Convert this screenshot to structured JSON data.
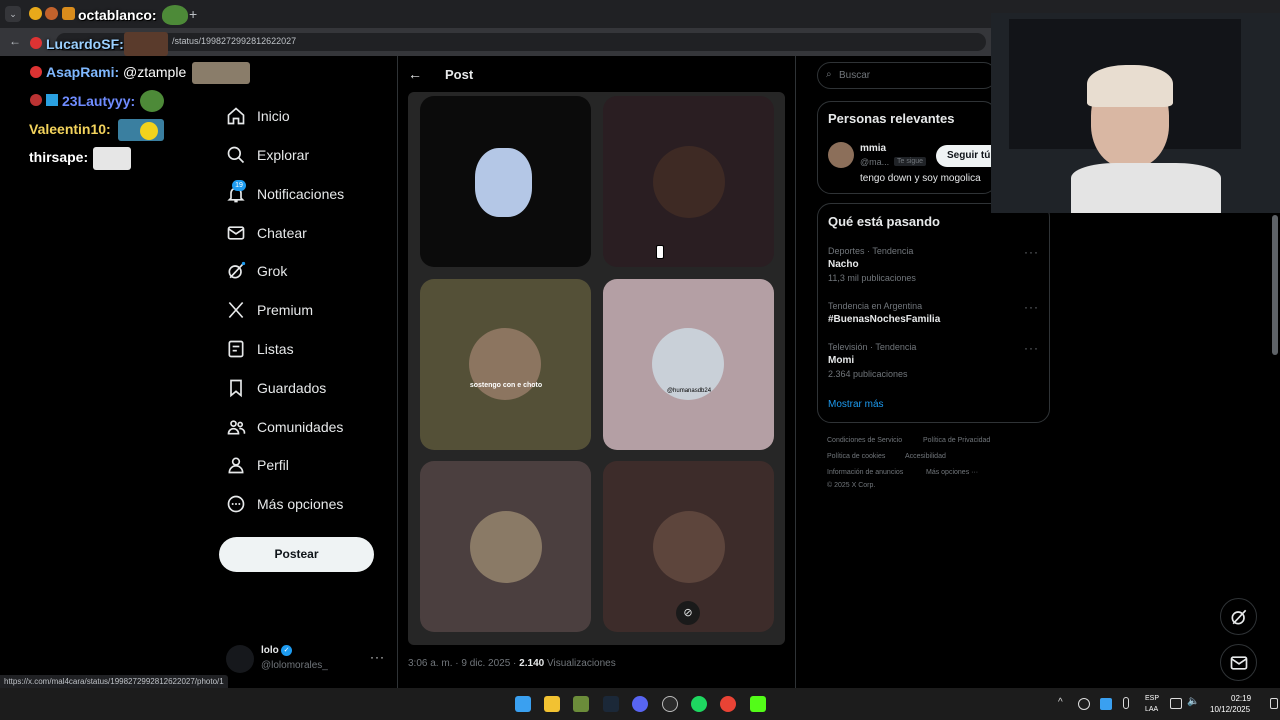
{
  "browser": {
    "url": "/status/1998272992812622027",
    "status_url": "https://x.com/mal4cara/status/1998272992812622027/photo/1"
  },
  "stream_chat": [
    {
      "user": "octablanco:",
      "message": ""
    },
    {
      "user": "LucardoSF:",
      "message": ""
    },
    {
      "user": "AsapRami:",
      "message": "@ztample"
    },
    {
      "user": "23Lautyyy:",
      "message": ""
    },
    {
      "user": "Valeentin10:",
      "message": ""
    },
    {
      "user": "thirsape:",
      "message": ""
    }
  ],
  "sidebar": {
    "items": [
      {
        "label": "Inicio",
        "icon": "home-icon"
      },
      {
        "label": "Explorar",
        "icon": "search-icon"
      },
      {
        "label": "Notificaciones",
        "icon": "bell-icon",
        "badge": "19"
      },
      {
        "label": "Chatear",
        "icon": "mail-icon"
      },
      {
        "label": "Grok",
        "icon": "grok-icon"
      },
      {
        "label": "Premium",
        "icon": "x-logo-icon"
      },
      {
        "label": "Listas",
        "icon": "list-icon"
      },
      {
        "label": "Guardados",
        "icon": "bookmark-icon"
      },
      {
        "label": "Comunidades",
        "icon": "communities-icon"
      },
      {
        "label": "Perfil",
        "icon": "person-icon"
      },
      {
        "label": "Más opciones",
        "icon": "more-circle-icon"
      }
    ],
    "post_button": "Postear",
    "account": {
      "name": "lolo",
      "handle": "@lolomorales_"
    }
  },
  "post": {
    "header": "Post",
    "meta_time": "3:06 a. m. · 9 dic. 2025 · ",
    "views_count": "2.140",
    "views_label": " Visualizaciones",
    "card_captions": {
      "c3": "sostengo con e choto",
      "c4": "@humanasdb24"
    }
  },
  "search": {
    "placeholder": "Buscar"
  },
  "relevant": {
    "title": "Personas relevantes",
    "name": "mmia",
    "handle": "@ma...",
    "follows_you": "Te sigue",
    "follow_button": "Seguir tú",
    "bio": "tengo down y soy mogolica"
  },
  "trends": {
    "title": "Qué está pasando",
    "items": [
      {
        "meta": "Deportes · Tendencia",
        "name": "Nacho",
        "posts": "11,3 mil publicaciones"
      },
      {
        "meta": "Tendencia en Argentina",
        "name": "#BuenasNochesFamilia",
        "posts": ""
      },
      {
        "meta": "Televisión · Tendencia",
        "name": "Momi",
        "posts": "2.364 publicaciones"
      }
    ],
    "show_more": "Mostrar más"
  },
  "footer_links": {
    "l1": "Condiciones de Servicio",
    "l2": "Política de Privacidad",
    "l3": "Política de cookies",
    "l4": "Accesibilidad",
    "l5": "Información de anuncios",
    "l6": "Más opciones ···",
    "l7": "© 2025 X Corp."
  },
  "taskbar": {
    "lang1": "ESP",
    "lang2": "LAA",
    "time": "02:19",
    "date": "10/12/2025"
  },
  "colors": {
    "accent": "#1d9bf0",
    "background": "#000000"
  }
}
